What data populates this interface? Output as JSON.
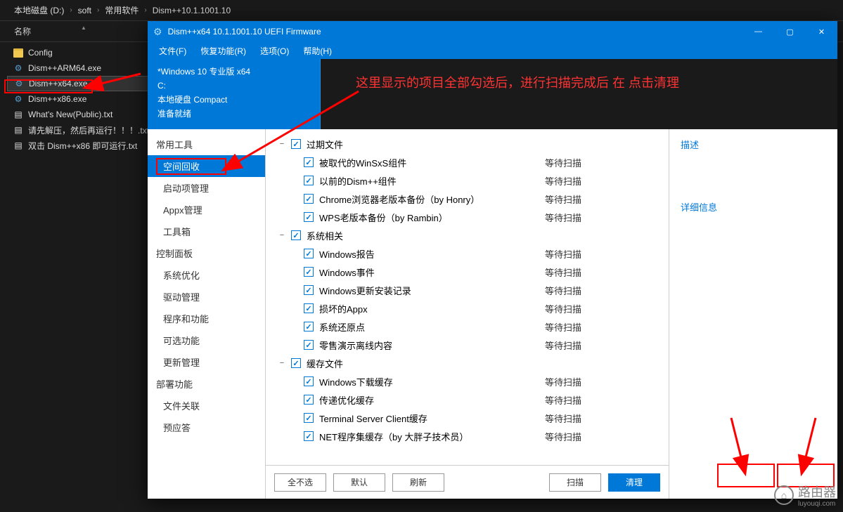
{
  "explorer": {
    "breadcrumb": [
      "本地磁盘 (D:)",
      "soft",
      "常用软件",
      "Dism++10.1.1001.10"
    ],
    "columns": {
      "name": "名称"
    },
    "files": [
      {
        "name": "Config",
        "type": "folder"
      },
      {
        "name": "Dism++ARM64.exe",
        "type": "exe"
      },
      {
        "name": "Dism++x64.exe",
        "type": "exe",
        "selected": true
      },
      {
        "name": "Dism++x86.exe",
        "type": "exe"
      },
      {
        "name": "What's New(Public).txt",
        "type": "txt"
      },
      {
        "name": "请先解压，然后再运行！！！.txt",
        "type": "txt"
      },
      {
        "name": "双击 Dism++x86 即可运行.txt",
        "type": "txt"
      }
    ]
  },
  "app": {
    "title": "Dism++x64 10.1.1001.10 UEFI Firmware",
    "menus": [
      "文件(F)",
      "恢复功能(R)",
      "选项(O)",
      "帮助(H)"
    ],
    "os": {
      "line1": "*Windows 10 专业版 x64",
      "line2": "C:",
      "line3": "本地硬盘 Compact",
      "line4": "准备就绪"
    },
    "annotation": "这里显示的项目全部勾选后，进行扫描完成后 在 点击清理",
    "sidebar": {
      "groups": [
        {
          "label": "常用工具",
          "items": [
            "空间回收",
            "启动项管理",
            "Appx管理",
            "工具箱"
          ]
        },
        {
          "label": "控制面板",
          "items": [
            "系统优化",
            "驱动管理",
            "程序和功能",
            "可选功能",
            "更新管理"
          ]
        },
        {
          "label": "部署功能",
          "items": [
            "文件关联",
            "预应答"
          ]
        }
      ],
      "selected": "空间回收"
    },
    "tree": [
      {
        "group": "过期文件",
        "items": [
          {
            "label": "被取代的WinSxS组件",
            "status": "等待扫描"
          },
          {
            "label": "以前的Dism++组件",
            "status": "等待扫描"
          },
          {
            "label": "Chrome浏览器老版本备份（by Honry）",
            "status": "等待扫描"
          },
          {
            "label": "WPS老版本备份（by Rambin）",
            "status": "等待扫描"
          }
        ]
      },
      {
        "group": "系统相关",
        "items": [
          {
            "label": "Windows报告",
            "status": "等待扫描"
          },
          {
            "label": "Windows事件",
            "status": "等待扫描"
          },
          {
            "label": "Windows更新安装记录",
            "status": "等待扫描"
          },
          {
            "label": "损坏的Appx",
            "status": "等待扫描"
          },
          {
            "label": "系统还原点",
            "status": "等待扫描"
          },
          {
            "label": "零售演示离线内容",
            "status": "等待扫描"
          }
        ]
      },
      {
        "group": "缓存文件",
        "items": [
          {
            "label": "Windows下载缓存",
            "status": "等待扫描"
          },
          {
            "label": "传递优化缓存",
            "status": "等待扫描"
          },
          {
            "label": "Terminal Server Client缓存",
            "status": "等待扫描"
          },
          {
            "label": "NET程序集缓存（by 大胖子技术员）",
            "status": "等待扫描"
          }
        ]
      }
    ],
    "footer": {
      "deselect_all": "全不选",
      "default": "默认",
      "refresh": "刷新",
      "scan": "扫描",
      "clean": "清理"
    },
    "rightpanel": {
      "desc": "描述",
      "details": "详细信息"
    }
  },
  "watermark": {
    "text": "路由器",
    "sub": "luyouqi.com"
  }
}
